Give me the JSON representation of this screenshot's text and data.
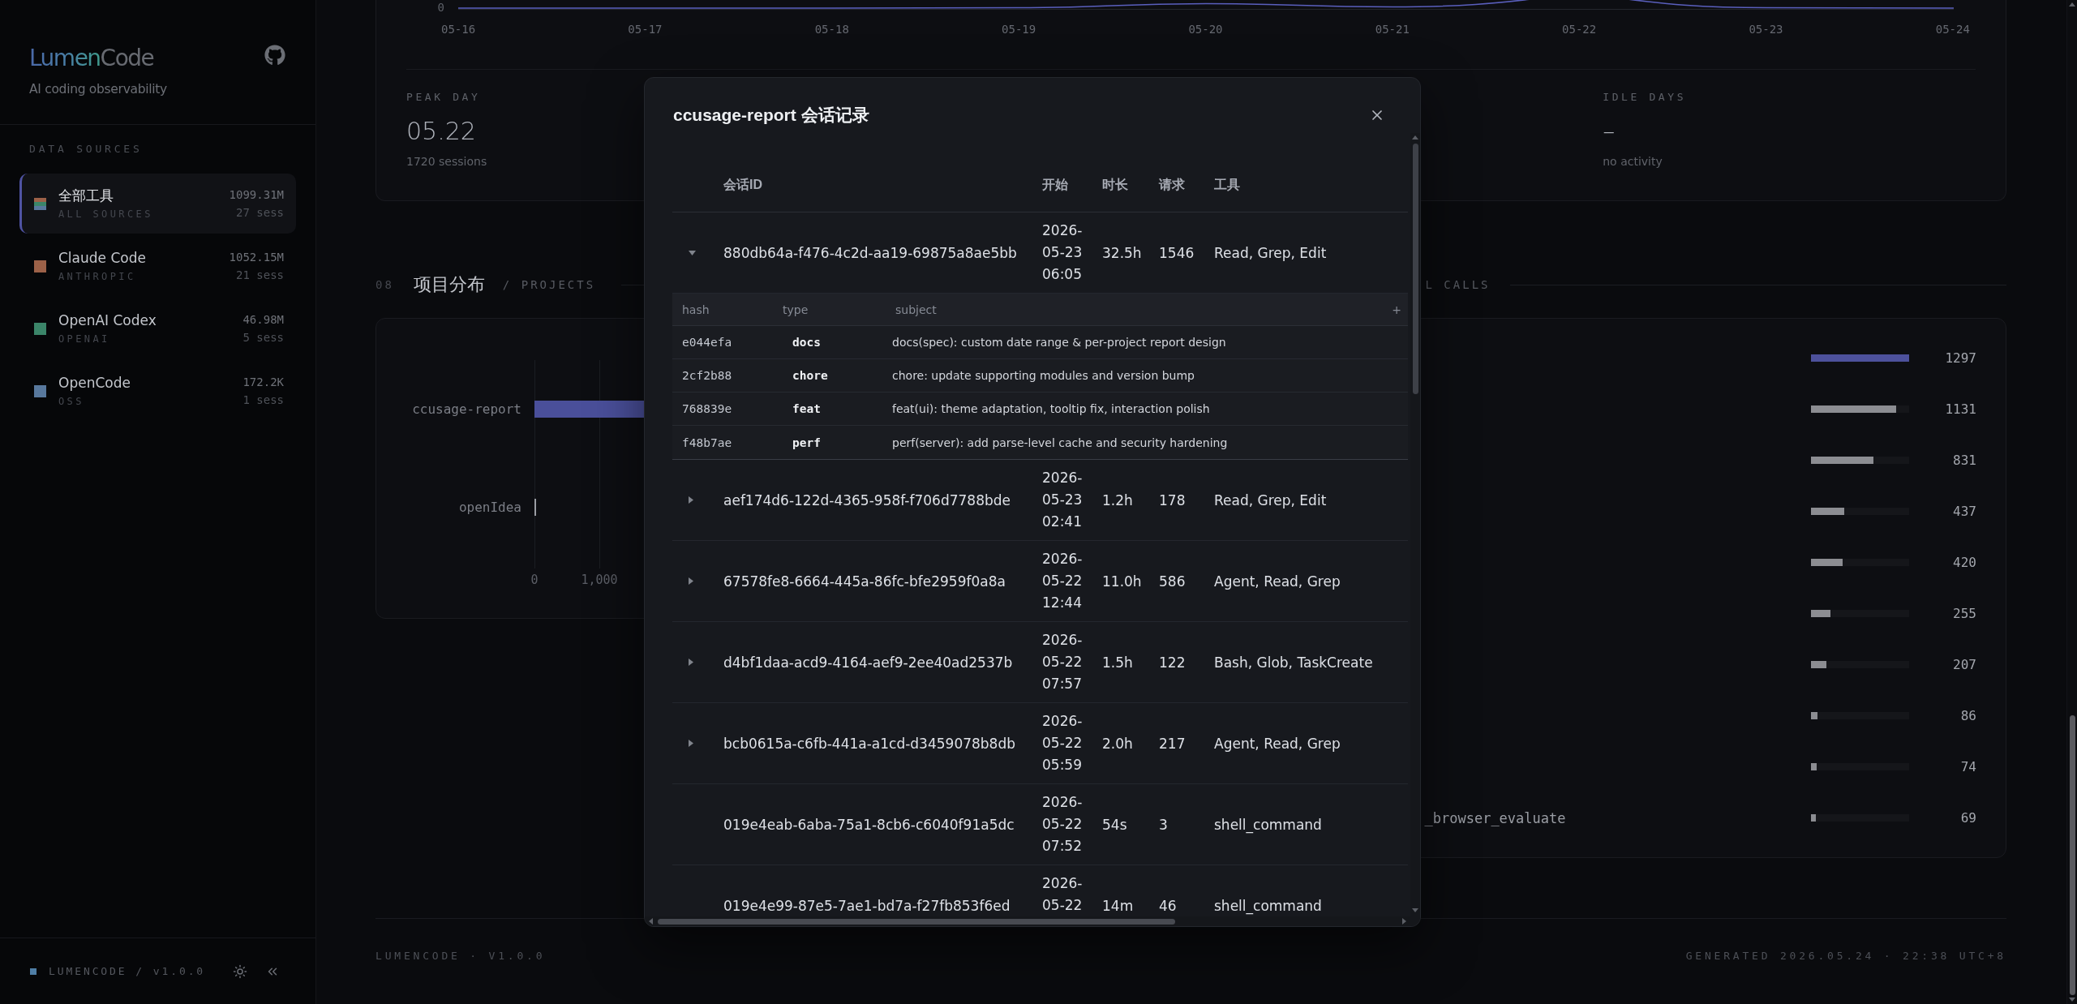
{
  "sidebar": {
    "brand": {
      "name_accent": "Lumen",
      "name_rest": "Code",
      "tagline": "AI coding observability"
    },
    "section_title": "DATA SOURCES",
    "sources": [
      {
        "kind": "all",
        "name": "全部工具",
        "vendor": "ALL SOURCES",
        "tokens": "1099.31M",
        "sessions": "27 sess",
        "selected": true
      },
      {
        "kind": "tool",
        "name": "Claude Code",
        "vendor": "ANTHROPIC",
        "tokens": "1052.15M",
        "sessions": "21 sess",
        "color": "#9c6148",
        "selected": false
      },
      {
        "kind": "tool",
        "name": "OpenAI Codex",
        "vendor": "OPENAI",
        "tokens": "46.98M",
        "sessions": "5 sess",
        "color": "#3b8569",
        "selected": false
      },
      {
        "kind": "tool",
        "name": "OpenCode",
        "vendor": "OSS",
        "tokens": "172.2K",
        "sessions": "1 sess",
        "color": "#58789d",
        "selected": false
      }
    ],
    "version": "LUMENCODE / v1.0.0"
  },
  "timeline": {
    "y_tick": "0",
    "x_labels": [
      "05-16",
      "05-17",
      "05-18",
      "05-19",
      "05-20",
      "05-21",
      "05-22",
      "05-23",
      "05-24"
    ]
  },
  "stats": [
    {
      "label": "PEAK DAY",
      "value": "05.22",
      "note": "1720 sessions"
    },
    {
      "label": "IDLE DAYS",
      "value": "–",
      "note": "no activity"
    }
  ],
  "projects": {
    "number": "08",
    "title": "项目分布",
    "subtitle": "/ PROJECTS",
    "categories": [
      "ccusage-report",
      "openIdea"
    ],
    "ticks": [
      "0",
      "1,000"
    ]
  },
  "tool_calls": {
    "subtitle": "L CALLS",
    "rows": [
      {
        "count": "1297",
        "level": 1,
        "highlight": true
      },
      {
        "count": "1131",
        "level": 0.872,
        "highlight": false
      },
      {
        "count": "831",
        "level": 0.643,
        "highlight": false
      },
      {
        "count": "437",
        "level": 0.345,
        "highlight": false
      },
      {
        "count": "420",
        "level": 0.323,
        "highlight": false
      },
      {
        "count": "255",
        "level": 0.2,
        "highlight": false
      },
      {
        "count": "207",
        "level": 0.16,
        "highlight": false
      },
      {
        "count": "86",
        "level": 0.07,
        "highlight": false
      },
      {
        "count": "74",
        "level": 0.06,
        "highlight": false
      },
      {
        "name": "_browser_evaluate",
        "count": "69",
        "level": 0.055,
        "highlight": false
      }
    ]
  },
  "footer": {
    "left": "LUMENCODE · V1.0.0",
    "right": "GENERATED 2026.05.24 · 22:38 UTC+8"
  },
  "modal": {
    "title": "ccusage-report 会话记录",
    "columns": [
      "会话ID",
      "开始",
      "时长",
      "请求",
      "工具"
    ],
    "commit_columns": [
      "hash",
      "type",
      "subject",
      "+"
    ],
    "sessions": [
      {
        "id": "880db64a-f476-4c2d-aa19-69875a8ae5bb",
        "start": "2026-05-23 06:05",
        "duration": "32.5h",
        "requests": "1546",
        "tools": "Read, Grep, Edit",
        "expanded": true,
        "commits": [
          {
            "hash": "e044efa",
            "type": "docs",
            "subject": "docs(spec): custom date range & per-project report design"
          },
          {
            "hash": "2cf2b88",
            "type": "chore",
            "subject": "chore: update supporting modules and version bump"
          },
          {
            "hash": "768839e",
            "type": "feat",
            "subject": "feat(ui): theme adaptation, tooltip fix, interaction polish"
          },
          {
            "hash": "f48b7ae",
            "type": "perf",
            "subject": "perf(server): add parse-level cache and security hardening"
          }
        ]
      },
      {
        "id": "aef174d6-122d-4365-958f-f706d7788bde",
        "start": "2026-05-23 02:41",
        "duration": "1.2h",
        "requests": "178",
        "tools": "Read, Grep, Edit",
        "expanded": false
      },
      {
        "id": "67578fe8-6664-445a-86fc-bfe2959f0a8a",
        "start": "2026-05-22 12:44",
        "duration": "11.0h",
        "requests": "586",
        "tools": "Agent, Read, Grep",
        "expanded": false
      },
      {
        "id": "d4bf1daa-acd9-4164-aef9-2ee40ad2537b",
        "start": "2026-05-22 07:57",
        "duration": "1.5h",
        "requests": "122",
        "tools": "Bash, Glob, TaskCreate",
        "expanded": false
      },
      {
        "id": "bcb0615a-c6fb-441a-a1cd-d3459078b8db",
        "start": "2026-05-22 05:59",
        "duration": "2.0h",
        "requests": "217",
        "tools": "Agent, Read, Grep",
        "expanded": false
      },
      {
        "id": "019e4eab-6aba-75a1-8cb6-c6040f91a5dc",
        "start": "2026-05-22 07:52",
        "duration": "54s",
        "requests": "3",
        "tools": "shell_command"
      },
      {
        "id": "019e4e99-87e5-7ae1-bd7a-f27fb853f6ed",
        "start": "2026-05-22",
        "duration": "14m",
        "requests": "46",
        "tools": "shell_command"
      }
    ]
  }
}
